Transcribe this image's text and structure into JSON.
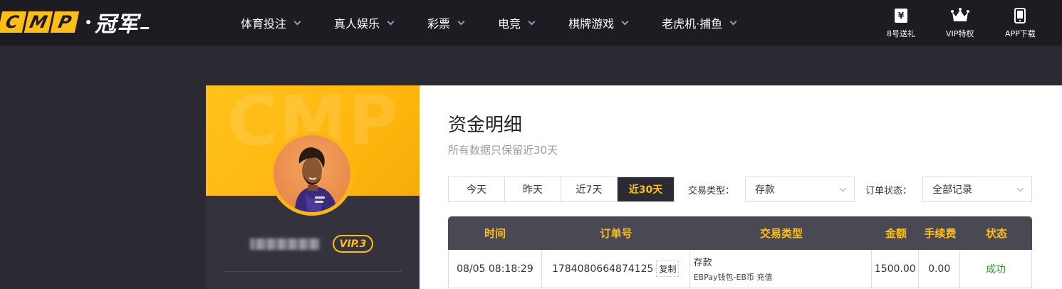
{
  "brand": {
    "logo_letters": [
      "C",
      "M",
      "P"
    ],
    "logo_cn": "冠军",
    "accent": "#ffbe16",
    "bg": "#2b2a33"
  },
  "nav": {
    "items": [
      {
        "label": "体育投注"
      },
      {
        "label": "真人娱乐"
      },
      {
        "label": "彩票"
      },
      {
        "label": "电竞"
      },
      {
        "label": "棋牌游戏"
      },
      {
        "label": "老虎机·捕鱼"
      }
    ]
  },
  "util": {
    "gift": {
      "label": "8号送礼",
      "icon": "ticket-yen-icon"
    },
    "vip": {
      "label": "VIP特权",
      "icon": "crown-icon"
    },
    "app": {
      "label": "APP下载",
      "icon": "phone-icon"
    }
  },
  "profile": {
    "watermark": "CMP",
    "vip_label": "VIP.3"
  },
  "main": {
    "title": "资金明细",
    "subtitle": "所有数据只保留近30天",
    "date_tabs": [
      {
        "label": "今天"
      },
      {
        "label": "昨天"
      },
      {
        "label": "近7天"
      },
      {
        "label": "近30天",
        "active": true
      }
    ],
    "filters": {
      "type_label": "交易类型：",
      "type_value": "存款",
      "status_label": "订单状态：",
      "status_value": "全部记录"
    },
    "table": {
      "columns": [
        "时间",
        "订单号",
        "交易类型",
        "金额",
        "手续费",
        "状态"
      ],
      "rows": [
        {
          "time": "08/05 08:18:29",
          "order_no": "1784080664874125",
          "copy_label": "复制",
          "type_main": "存款",
          "type_sub": "EBPay钱包-EB币 充值",
          "amount": "1500.00",
          "fee": "0.00",
          "status": "成功",
          "status_color": "#2e9a35"
        }
      ]
    }
  }
}
